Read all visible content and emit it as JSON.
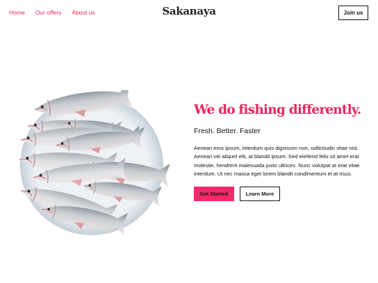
{
  "nav": {
    "links": [
      "Home",
      "Our offers",
      "About us"
    ],
    "brand": "Sakanaya",
    "join_label": "Join us"
  },
  "hero": {
    "image_icon": "fish-platter-image",
    "headline": "We do fishing differently.",
    "tagline": "Fresh. Better. Faster",
    "body": "Aenean eros ipsum, interdum quis dignissim non, sollicitudin vitae nisl. Aenean vel aliquet elit, at blandit ipsum. Sed eleifend felis sit amet erat molestie, hendrerit malesuada justo ultrices. Nunc volutpat at erat vitae interdum. Ut nec massa eget lorem blandit condimentum et at risus.",
    "primary_cta": "Get Started",
    "secondary_cta": "Learn More"
  },
  "colors": {
    "accent": "#e8275a",
    "button_accent": "#f7296a"
  }
}
